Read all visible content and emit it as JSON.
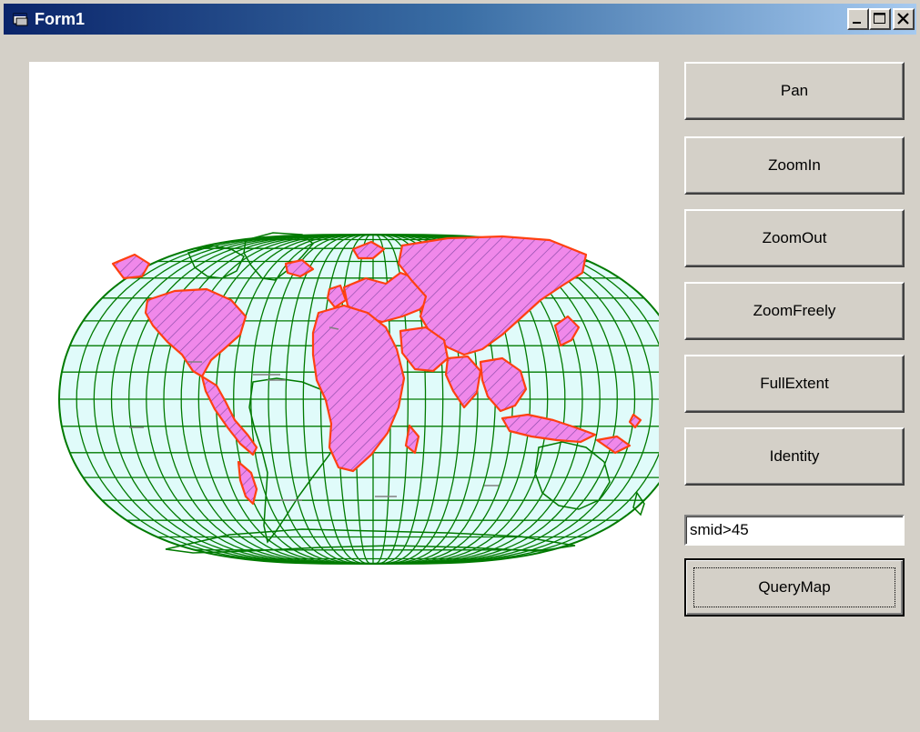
{
  "window": {
    "title": "Form1"
  },
  "colors": {
    "ocean": "#e0fbfa",
    "graticule": "#007a00",
    "land_fill": "#f088ea",
    "land_outline": "#ff4010",
    "hatch": "#8a4aa8"
  },
  "toolbar": {
    "pan_label": "Pan",
    "zoomin_label": "ZoomIn",
    "zoomout_label": "ZoomOut",
    "zoomfreely_label": "ZoomFreely",
    "fullextent_label": "FullExtent",
    "identity_label": "Identity",
    "querymap_label": "QueryMap"
  },
  "query": {
    "value": "smid>45"
  }
}
